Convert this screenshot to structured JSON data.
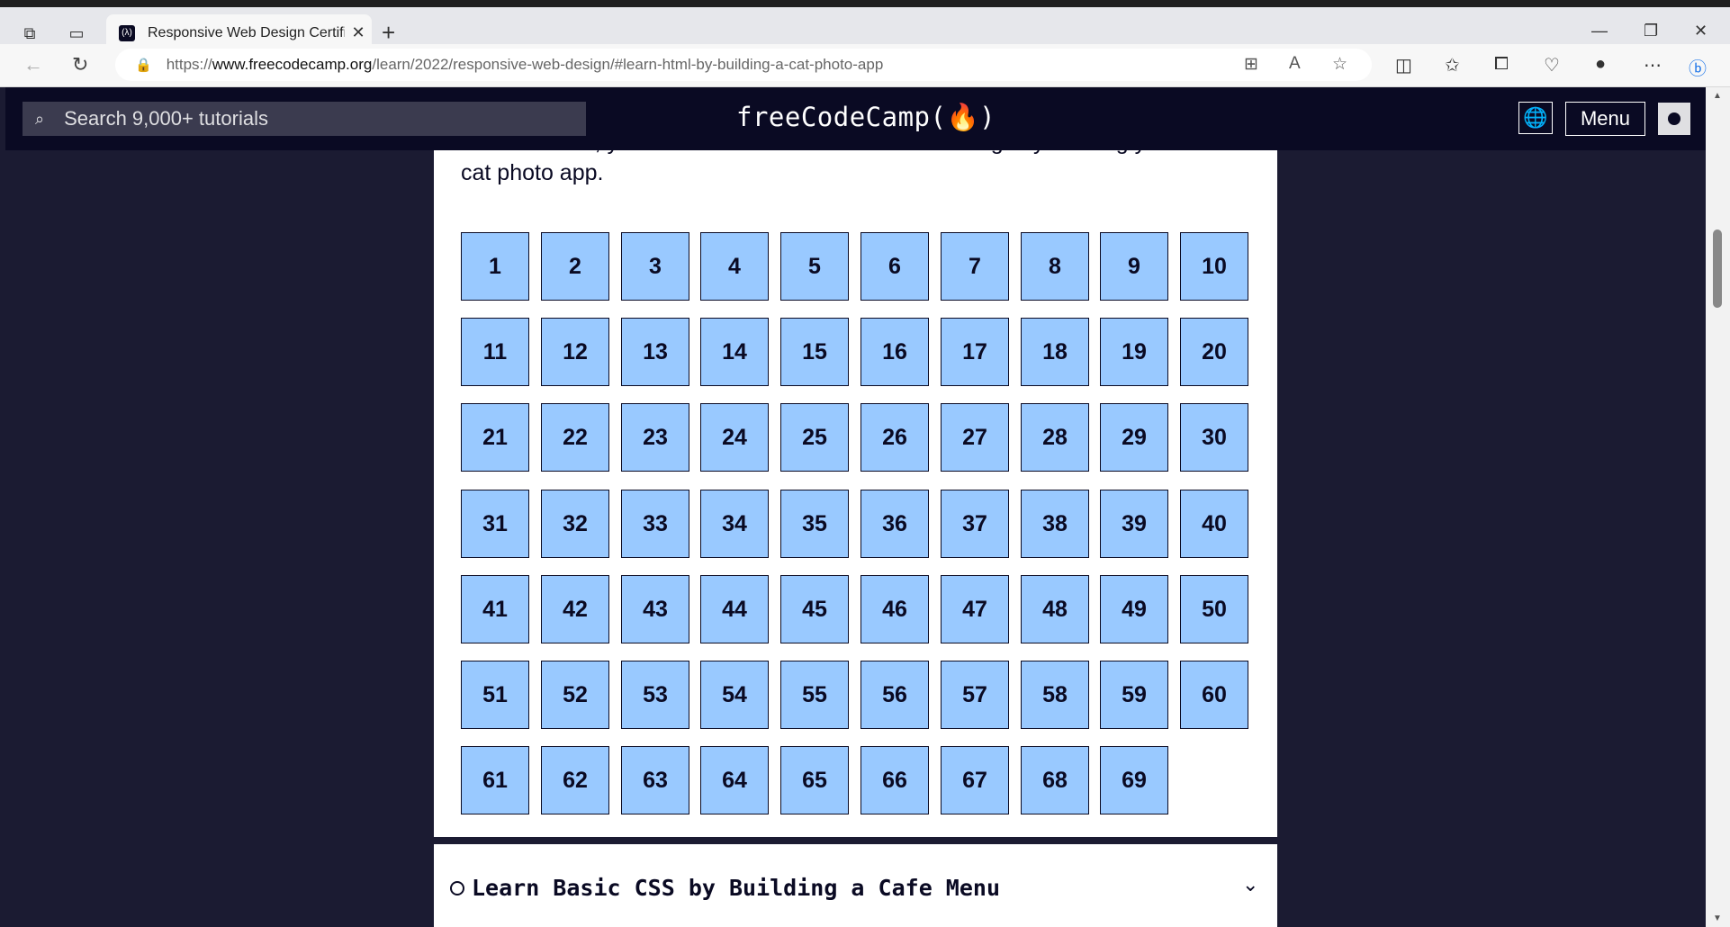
{
  "browser": {
    "tab_title": "Responsive Web Design Certificati",
    "url_prefix": "https://",
    "url_host": "www.freecodecamp.org",
    "url_path": "/learn/2022/responsive-web-design/#learn-html-by-building-a-cat-photo-app",
    "favicon": "(λ)"
  },
  "nav": {
    "search_placeholder": "Search 9,000+ tutorials",
    "logo_text": "freeCodeCamp(🔥)",
    "menu_label": "Menu",
    "globe_icon": "🌐"
  },
  "course": {
    "intro": "In this course, you'll learn the most common HTML tags by building your own cat photo app.",
    "steps": [
      "1",
      "2",
      "3",
      "4",
      "5",
      "6",
      "7",
      "8",
      "9",
      "10",
      "11",
      "12",
      "13",
      "14",
      "15",
      "16",
      "17",
      "18",
      "19",
      "20",
      "21",
      "22",
      "23",
      "24",
      "25",
      "26",
      "27",
      "28",
      "29",
      "30",
      "31",
      "32",
      "33",
      "34",
      "35",
      "36",
      "37",
      "38",
      "39",
      "40",
      "41",
      "42",
      "43",
      "44",
      "45",
      "46",
      "47",
      "48",
      "49",
      "50",
      "51",
      "52",
      "53",
      "54",
      "55",
      "56",
      "57",
      "58",
      "59",
      "60",
      "61",
      "62",
      "63",
      "64",
      "65",
      "66",
      "67",
      "68",
      "69"
    ]
  },
  "next_block": {
    "title": "Learn Basic CSS by Building a Cafe Menu"
  },
  "colors": {
    "nav_bg": "#0a0a23",
    "step_bg": "#99c9ff",
    "page_bg": "#1b1b32"
  }
}
